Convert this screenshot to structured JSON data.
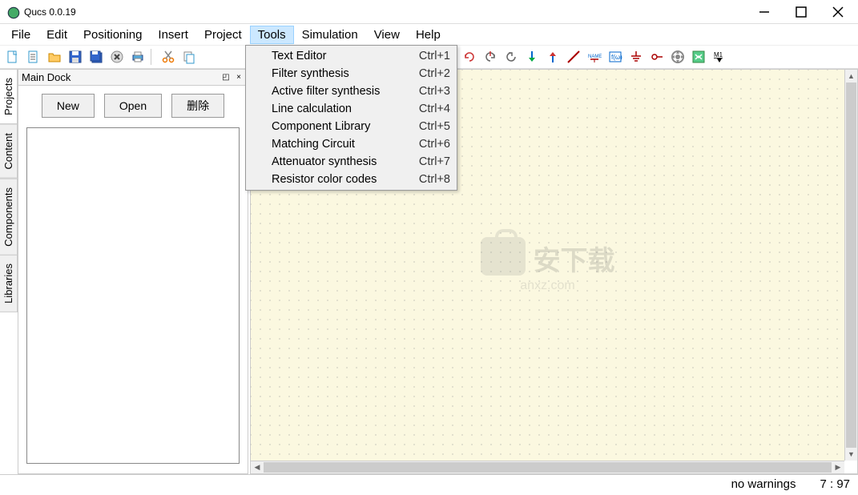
{
  "window": {
    "title": "Qucs 0.0.19"
  },
  "menubar": [
    "File",
    "Edit",
    "Positioning",
    "Insert",
    "Project",
    "Tools",
    "Simulation",
    "View",
    "Help"
  ],
  "active_menu": "Tools",
  "tools_menu": [
    {
      "label": "Text Editor",
      "shortcut": "Ctrl+1"
    },
    {
      "label": "Filter synthesis",
      "shortcut": "Ctrl+2"
    },
    {
      "label": "Active filter synthesis",
      "shortcut": "Ctrl+3"
    },
    {
      "label": "Line calculation",
      "shortcut": "Ctrl+4"
    },
    {
      "label": "Component Library",
      "shortcut": "Ctrl+5"
    },
    {
      "label": "Matching Circuit",
      "shortcut": "Ctrl+6"
    },
    {
      "label": "Attenuator synthesis",
      "shortcut": "Ctrl+7"
    },
    {
      "label": "Resistor color codes",
      "shortcut": "Ctrl+8"
    }
  ],
  "dock": {
    "title": "Main Dock",
    "buttons": {
      "new": "New",
      "open": "Open",
      "delete": "删除"
    }
  },
  "side_tabs": [
    "Projects",
    "Content",
    "Components",
    "Libraries"
  ],
  "statusbar": {
    "warnings": "no warnings",
    "position": "7 : 97"
  },
  "watermark": {
    "text1": "安下载",
    "text2": "anxz.com"
  }
}
